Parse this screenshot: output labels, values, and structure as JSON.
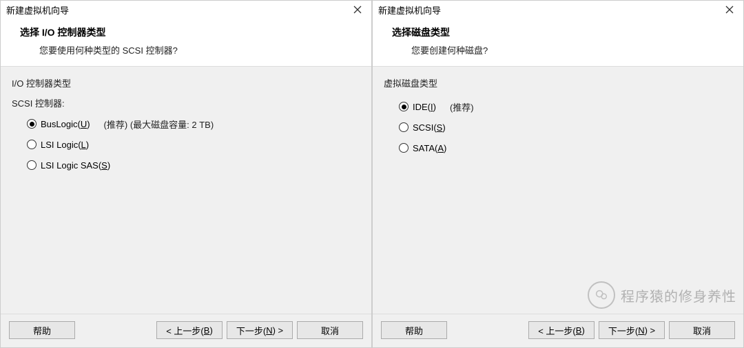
{
  "left": {
    "window_title": "新建虚拟机向导",
    "header_title": "选择 I/O 控制器类型",
    "header_sub": "您要使用何种类型的 SCSI 控制器?",
    "group_label": "I/O 控制器类型",
    "sub_label": "SCSI 控制器:",
    "options": [
      {
        "prefix": "BusLogic(",
        "mnemonic": "U",
        "suffix": ")",
        "selected": true,
        "extra": "(推荐) (最大磁盘容量: 2 TB)"
      },
      {
        "prefix": "LSI Logic(",
        "mnemonic": "L",
        "suffix": ")",
        "selected": false,
        "extra": ""
      },
      {
        "prefix": "LSI Logic SAS(",
        "mnemonic": "S",
        "suffix": ")",
        "selected": false,
        "extra": ""
      }
    ],
    "buttons": {
      "help": "帮助",
      "back_prefix": "< 上一步(",
      "back_mnemonic": "B",
      "back_suffix": ")",
      "next_prefix": "下一步(",
      "next_mnemonic": "N",
      "next_suffix": ") >",
      "cancel": "取消"
    }
  },
  "right": {
    "window_title": "新建虚拟机向导",
    "header_title": "选择磁盘类型",
    "header_sub": "您要创建何种磁盘?",
    "group_label": "虚拟磁盘类型",
    "options": [
      {
        "prefix": "IDE(",
        "mnemonic": "I",
        "suffix": ")",
        "selected": true,
        "extra": "(推荐)"
      },
      {
        "prefix": "SCSI(",
        "mnemonic": "S",
        "suffix": ")",
        "selected": false,
        "extra": ""
      },
      {
        "prefix": "SATA(",
        "mnemonic": "A",
        "suffix": ")",
        "selected": false,
        "extra": ""
      }
    ],
    "buttons": {
      "help": "帮助",
      "back_prefix": "< 上一步(",
      "back_mnemonic": "B",
      "back_suffix": ")",
      "next_prefix": "下一步(",
      "next_mnemonic": "N",
      "next_suffix": ") >",
      "cancel": "取消"
    }
  },
  "watermark": "程序猿的修身养性"
}
